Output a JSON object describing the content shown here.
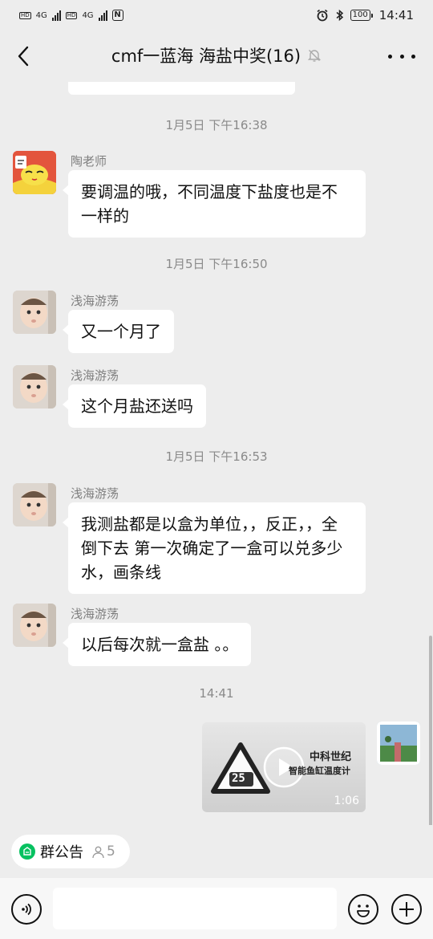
{
  "status_bar": {
    "network": "4G",
    "battery": "100",
    "time": "14:41"
  },
  "header": {
    "title": "cmf一蓝海 海盐中奖(16)"
  },
  "messages": [
    {
      "type": "time",
      "text": "1月5日 下午16:38"
    },
    {
      "type": "msg",
      "sender": "陶老师",
      "avatar": "cartoon-red",
      "text": "要调温的哦，不同温度下盐度也是不一样的"
    },
    {
      "type": "time",
      "text": "1月5日 下午16:50"
    },
    {
      "type": "msg",
      "sender": "浅海游荡",
      "avatar": "baby",
      "text": "又一个月了"
    },
    {
      "type": "msg",
      "sender": "浅海游荡",
      "avatar": "baby",
      "text": "这个月盐还送吗"
    },
    {
      "type": "time",
      "text": "1月5日 下午16:53"
    },
    {
      "type": "msg",
      "sender": "浅海游荡",
      "avatar": "baby",
      "text": "我测盐都是以盒为单位，，反正，，全倒下去 第一次确定了一盒可以兑多少水，画条线"
    },
    {
      "type": "msg",
      "sender": "浅海游荡",
      "avatar": "baby",
      "text": "以后每次就一盒盐 。。"
    },
    {
      "type": "time",
      "text": "14:41"
    },
    {
      "type": "video",
      "sender": "self",
      "duration": "1:06",
      "thumb_title": "中科世纪",
      "thumb_subtitle": "智能鱼缸温度计",
      "thumb_reading": "25"
    }
  ],
  "notice": {
    "label": "群公告",
    "count": "5"
  },
  "input": {
    "placeholder": ""
  },
  "colors": {
    "background": "#ededed",
    "bubble": "#ffffff",
    "announcement_icon": "#07c160"
  }
}
